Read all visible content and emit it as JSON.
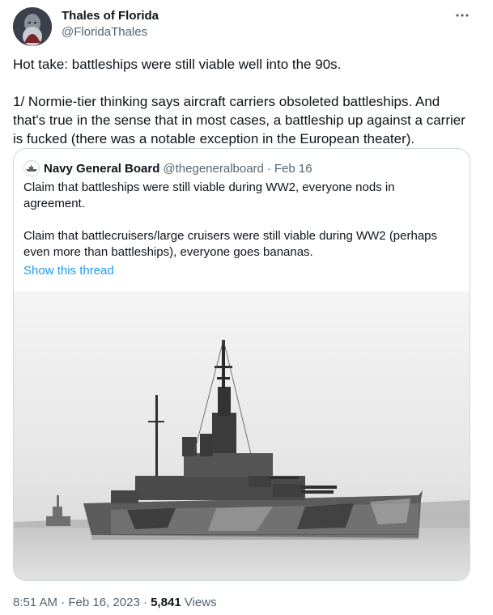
{
  "author": {
    "name": "Thales of Florida",
    "handle": "@FloridaThales"
  },
  "tweet": {
    "paragraphs": [
      "Hot take: battleships were still viable well into the 90s.",
      "1/ Normie-tier thinking says aircraft carriers obsoleted battleships. And that's true in the sense that in most cases, a battleship up against a carrier is fucked (there was a notable exception in the European theater)."
    ]
  },
  "quote": {
    "name": "Navy General Board",
    "handle": "@thegeneralboard",
    "separator": "·",
    "date": "Feb 16",
    "paragraphs": [
      "Claim that battleships were still viable during WW2, everyone nods in agreement.",
      "Claim that battlecruisers/large cruisers were still viable during WW2 (perhaps even more than battleships), everyone goes bananas."
    ],
    "show_thread": "Show this thread"
  },
  "meta": {
    "time": "8:51 AM",
    "sep": "·",
    "date": "Feb 16, 2023",
    "views_count": "5,841",
    "views_label": "Views"
  },
  "icons": {
    "more": "more-horizontal-icon"
  },
  "colors": {
    "link": "#1d9bf0",
    "secondary_text": "#536471",
    "border": "#cfd9de"
  }
}
